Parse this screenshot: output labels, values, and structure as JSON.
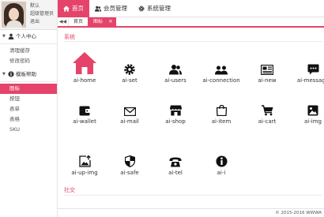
{
  "user": {
    "name": "默认",
    "role": "超级管理员",
    "logout": "退出"
  },
  "sidebar": {
    "groups": [
      {
        "title": "个人中心",
        "items": [
          "清理缓存",
          "修改密码"
        ]
      },
      {
        "title": "模板帮助",
        "items": [
          "图标",
          "按钮",
          "表单",
          "表格",
          "SKU"
        ]
      }
    ]
  },
  "topnav": [
    {
      "label": "首页",
      "icon": "home-icon",
      "active": true
    },
    {
      "label": "会员管理",
      "icon": "users-icon",
      "active": false
    },
    {
      "label": "系统管理",
      "icon": "gear-icon",
      "active": false
    }
  ],
  "tabs": {
    "back_icon": "◀◀",
    "items": [
      {
        "label": "首页",
        "active": false
      },
      {
        "label": "图标",
        "active": true,
        "close": "×"
      }
    ]
  },
  "sections": [
    {
      "title": "系统"
    },
    {
      "title": "社交"
    }
  ],
  "icons": [
    {
      "name": "ai-home",
      "icon": "home-icon"
    },
    {
      "name": "ai-set",
      "icon": "gear-icon"
    },
    {
      "name": "ai-users",
      "icon": "users-icon"
    },
    {
      "name": "ai-connection",
      "icon": "connection-icon"
    },
    {
      "name": "ai-new",
      "icon": "news-icon"
    },
    {
      "name": "ai-message",
      "icon": "message-icon"
    },
    {
      "name": "ai-wallet",
      "icon": "wallet-icon"
    },
    {
      "name": "ai-mail",
      "icon": "mail-icon"
    },
    {
      "name": "ai-shop",
      "icon": "shop-icon"
    },
    {
      "name": "ai-item",
      "icon": "bag-icon"
    },
    {
      "name": "ai-cart",
      "icon": "cart-icon"
    },
    {
      "name": "ai-img",
      "icon": "image-icon"
    },
    {
      "name": "ai-up-img",
      "icon": "upload-image-icon"
    },
    {
      "name": "ai-safe",
      "icon": "shield-icon"
    },
    {
      "name": "ai-tel",
      "icon": "phone-icon"
    },
    {
      "name": "ai-i",
      "icon": "info-icon"
    }
  ],
  "footer": "© 2015-2016 WWWA",
  "colors": {
    "accent": "#e5436a",
    "icon": "#111111"
  }
}
